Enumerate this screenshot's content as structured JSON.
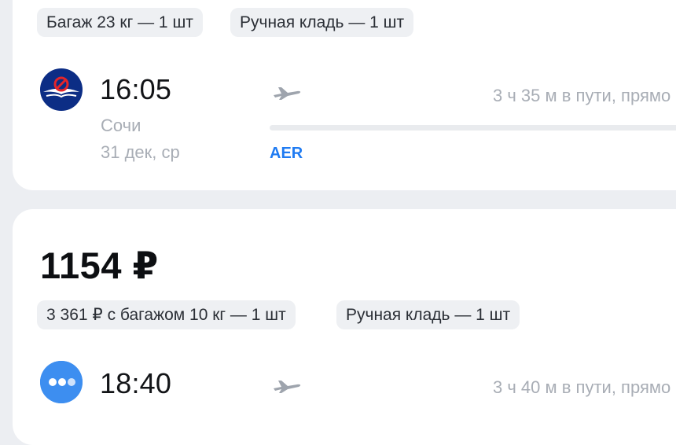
{
  "flights": [
    {
      "badges": [
        "Багаж 23 кг — 1 шт",
        "Ручная кладь — 1 шт"
      ],
      "airline_icon": "aeroflot-logo-icon",
      "departure_time": "16:05",
      "city": "Сочи",
      "date": "31 дек, ср",
      "duration": "3 ч 35 м в пути, прямо",
      "origin_code": "AER"
    },
    {
      "price": "1154 ₽",
      "badges": [
        "3 361 ₽ с багажом 10 кг — 1 шт",
        "Ручная кладь — 1 шт"
      ],
      "airline_icon": "airline-dots-logo-icon",
      "departure_time": "18:40",
      "duration": "3 ч 40 м в пути, прямо"
    }
  ],
  "colors": {
    "background": "#eceef2",
    "card": "#ffffff",
    "chip": "#eef0f3",
    "accent": "#1f7bf2",
    "aeroflot_blue": "#0c2d85",
    "muted_text": "#a8adb5"
  }
}
